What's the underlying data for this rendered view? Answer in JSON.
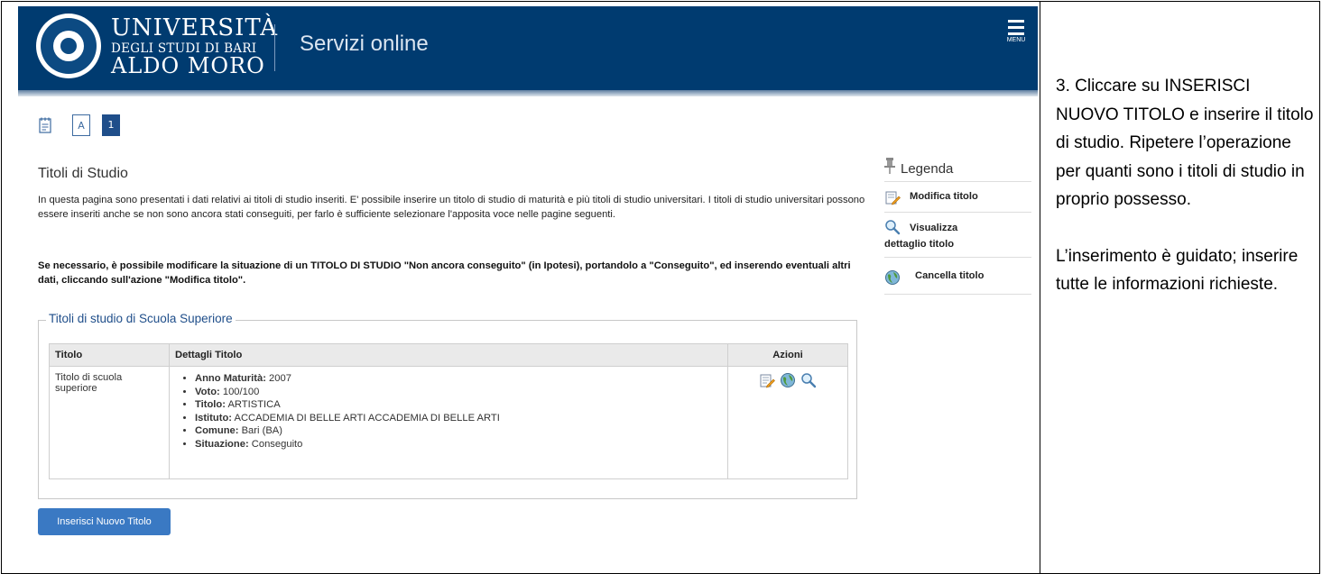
{
  "header": {
    "uni_line1": "UNIVERSITÀ",
    "uni_line2": "DEGLI STUDI DI BARI",
    "uni_line3": "ALDO MORO",
    "service_title": "Servizi online",
    "menu_label": "MENU",
    "bar_color": "#003b70"
  },
  "steps": {
    "step_a": "A",
    "step_1": "1"
  },
  "page": {
    "title": "Titoli di Studio",
    "description": "In questa pagina sono presentati i dati relativi ai titoli di studio inseriti. E' possibile inserire un titolo di studio di maturità e più titoli di studio universitari. I titoli di studio universitari possono essere inseriti anche se non sono ancora stati conseguiti, per farlo è sufficiente selezionare l'apposita voce nelle pagine seguenti.",
    "description_bold": "Se necessario, è possibile modificare la situazione di un TITOLO DI STUDIO \"Non ancora conseguito\" (in Ipotesi), portandolo a \"Conseguito\", ed inserendo eventuali altri dati, cliccando sull'azione \"Modifica titolo\"."
  },
  "section": {
    "legend": "Titoli di studio di Scuola Superiore",
    "headers": {
      "titolo": "Titolo",
      "dettagli": "Dettagli Titolo",
      "azioni": "Azioni"
    },
    "row": {
      "titolo": "Titolo di scuola superiore",
      "details": [
        {
          "label": "Anno Maturità:",
          "value": "2007"
        },
        {
          "label": "Voto:",
          "value": "100/100"
        },
        {
          "label": "Titolo:",
          "value": "ARTISTICA"
        },
        {
          "label": "Istituto:",
          "value": "ACCADEMIA DI BELLE ARTI ACCADEMIA DI BELLE ARTI"
        },
        {
          "label": "Comune:",
          "value": "Bari (BA)"
        },
        {
          "label": "Situazione:",
          "value": "Conseguito"
        }
      ],
      "action_icons": [
        "edit-icon",
        "globe-delete-icon",
        "magnifier-icon"
      ]
    }
  },
  "insert_button": "Inserisci Nuovo Titolo",
  "legenda": {
    "title": "Legenda",
    "items": [
      {
        "icon": "edit-icon",
        "label": "Modifica titolo"
      },
      {
        "icon": "magnifier-icon",
        "label": "Visualizza dettaglio titolo"
      },
      {
        "icon": "globe-delete-icon",
        "label": "Cancella titolo"
      }
    ]
  },
  "instructions": {
    "para1": "3. Cliccare su INSERISCI NUOVO TITOLO e inserire il titolo di studio. Ripetere l’operazione per quanti sono i  titoli di studio in proprio possesso.",
    "para2": "L’inserimento è guidato; inserire tutte le informazioni richieste."
  }
}
